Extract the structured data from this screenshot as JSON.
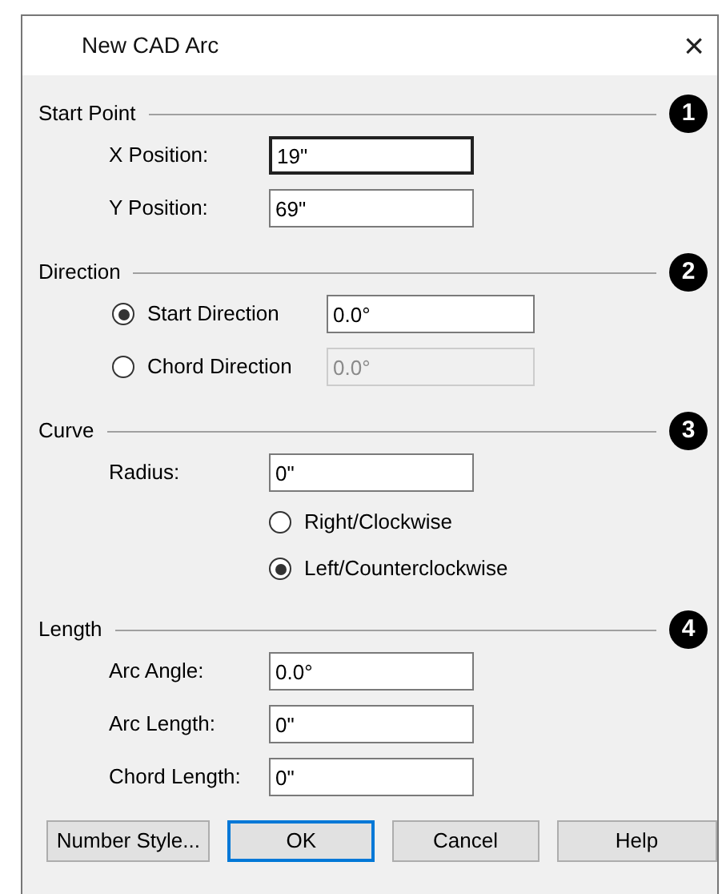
{
  "window": {
    "title": "New CAD Arc",
    "close": "×"
  },
  "sections": [
    {
      "title": "Start Point",
      "badge": "1",
      "rows": [
        {
          "kind": "field",
          "label": "X Position:",
          "value": "19\"",
          "focused": true,
          "disabled": false
        },
        {
          "kind": "field",
          "label": "Y Position:",
          "value": "69\"",
          "focused": false,
          "disabled": false
        }
      ]
    },
    {
      "title": "Direction",
      "badge": "2",
      "rows": [
        {
          "kind": "radio_field",
          "label": "Start Direction",
          "selected": true,
          "value": "0.0°",
          "disabled": false
        },
        {
          "kind": "radio_field",
          "label": "Chord Direction",
          "selected": false,
          "value": "0.0°",
          "disabled": true
        }
      ]
    },
    {
      "title": "Curve",
      "badge": "3",
      "rows": [
        {
          "kind": "field",
          "label": "Radius:",
          "value": "0\"",
          "focused": false,
          "disabled": false
        },
        {
          "kind": "radio",
          "label": "Right/Clockwise",
          "selected": false
        },
        {
          "kind": "radio",
          "label": "Left/Counterclockwise",
          "selected": true
        }
      ]
    },
    {
      "title": "Length",
      "badge": "4",
      "rows": [
        {
          "kind": "field",
          "label": "Arc Angle:",
          "value": "0.0°",
          "focused": false,
          "disabled": false
        },
        {
          "kind": "field",
          "label": "Arc Length:",
          "value": "0\"",
          "focused": false,
          "disabled": false
        },
        {
          "kind": "field",
          "label": "Chord Length:",
          "value": "0\"",
          "focused": false,
          "disabled": false
        }
      ]
    }
  ],
  "buttons": [
    {
      "label": "Number Style...",
      "default": false
    },
    {
      "label": "OK",
      "default": true
    },
    {
      "label": "Cancel",
      "default": false
    },
    {
      "label": "Help",
      "default": false
    }
  ]
}
